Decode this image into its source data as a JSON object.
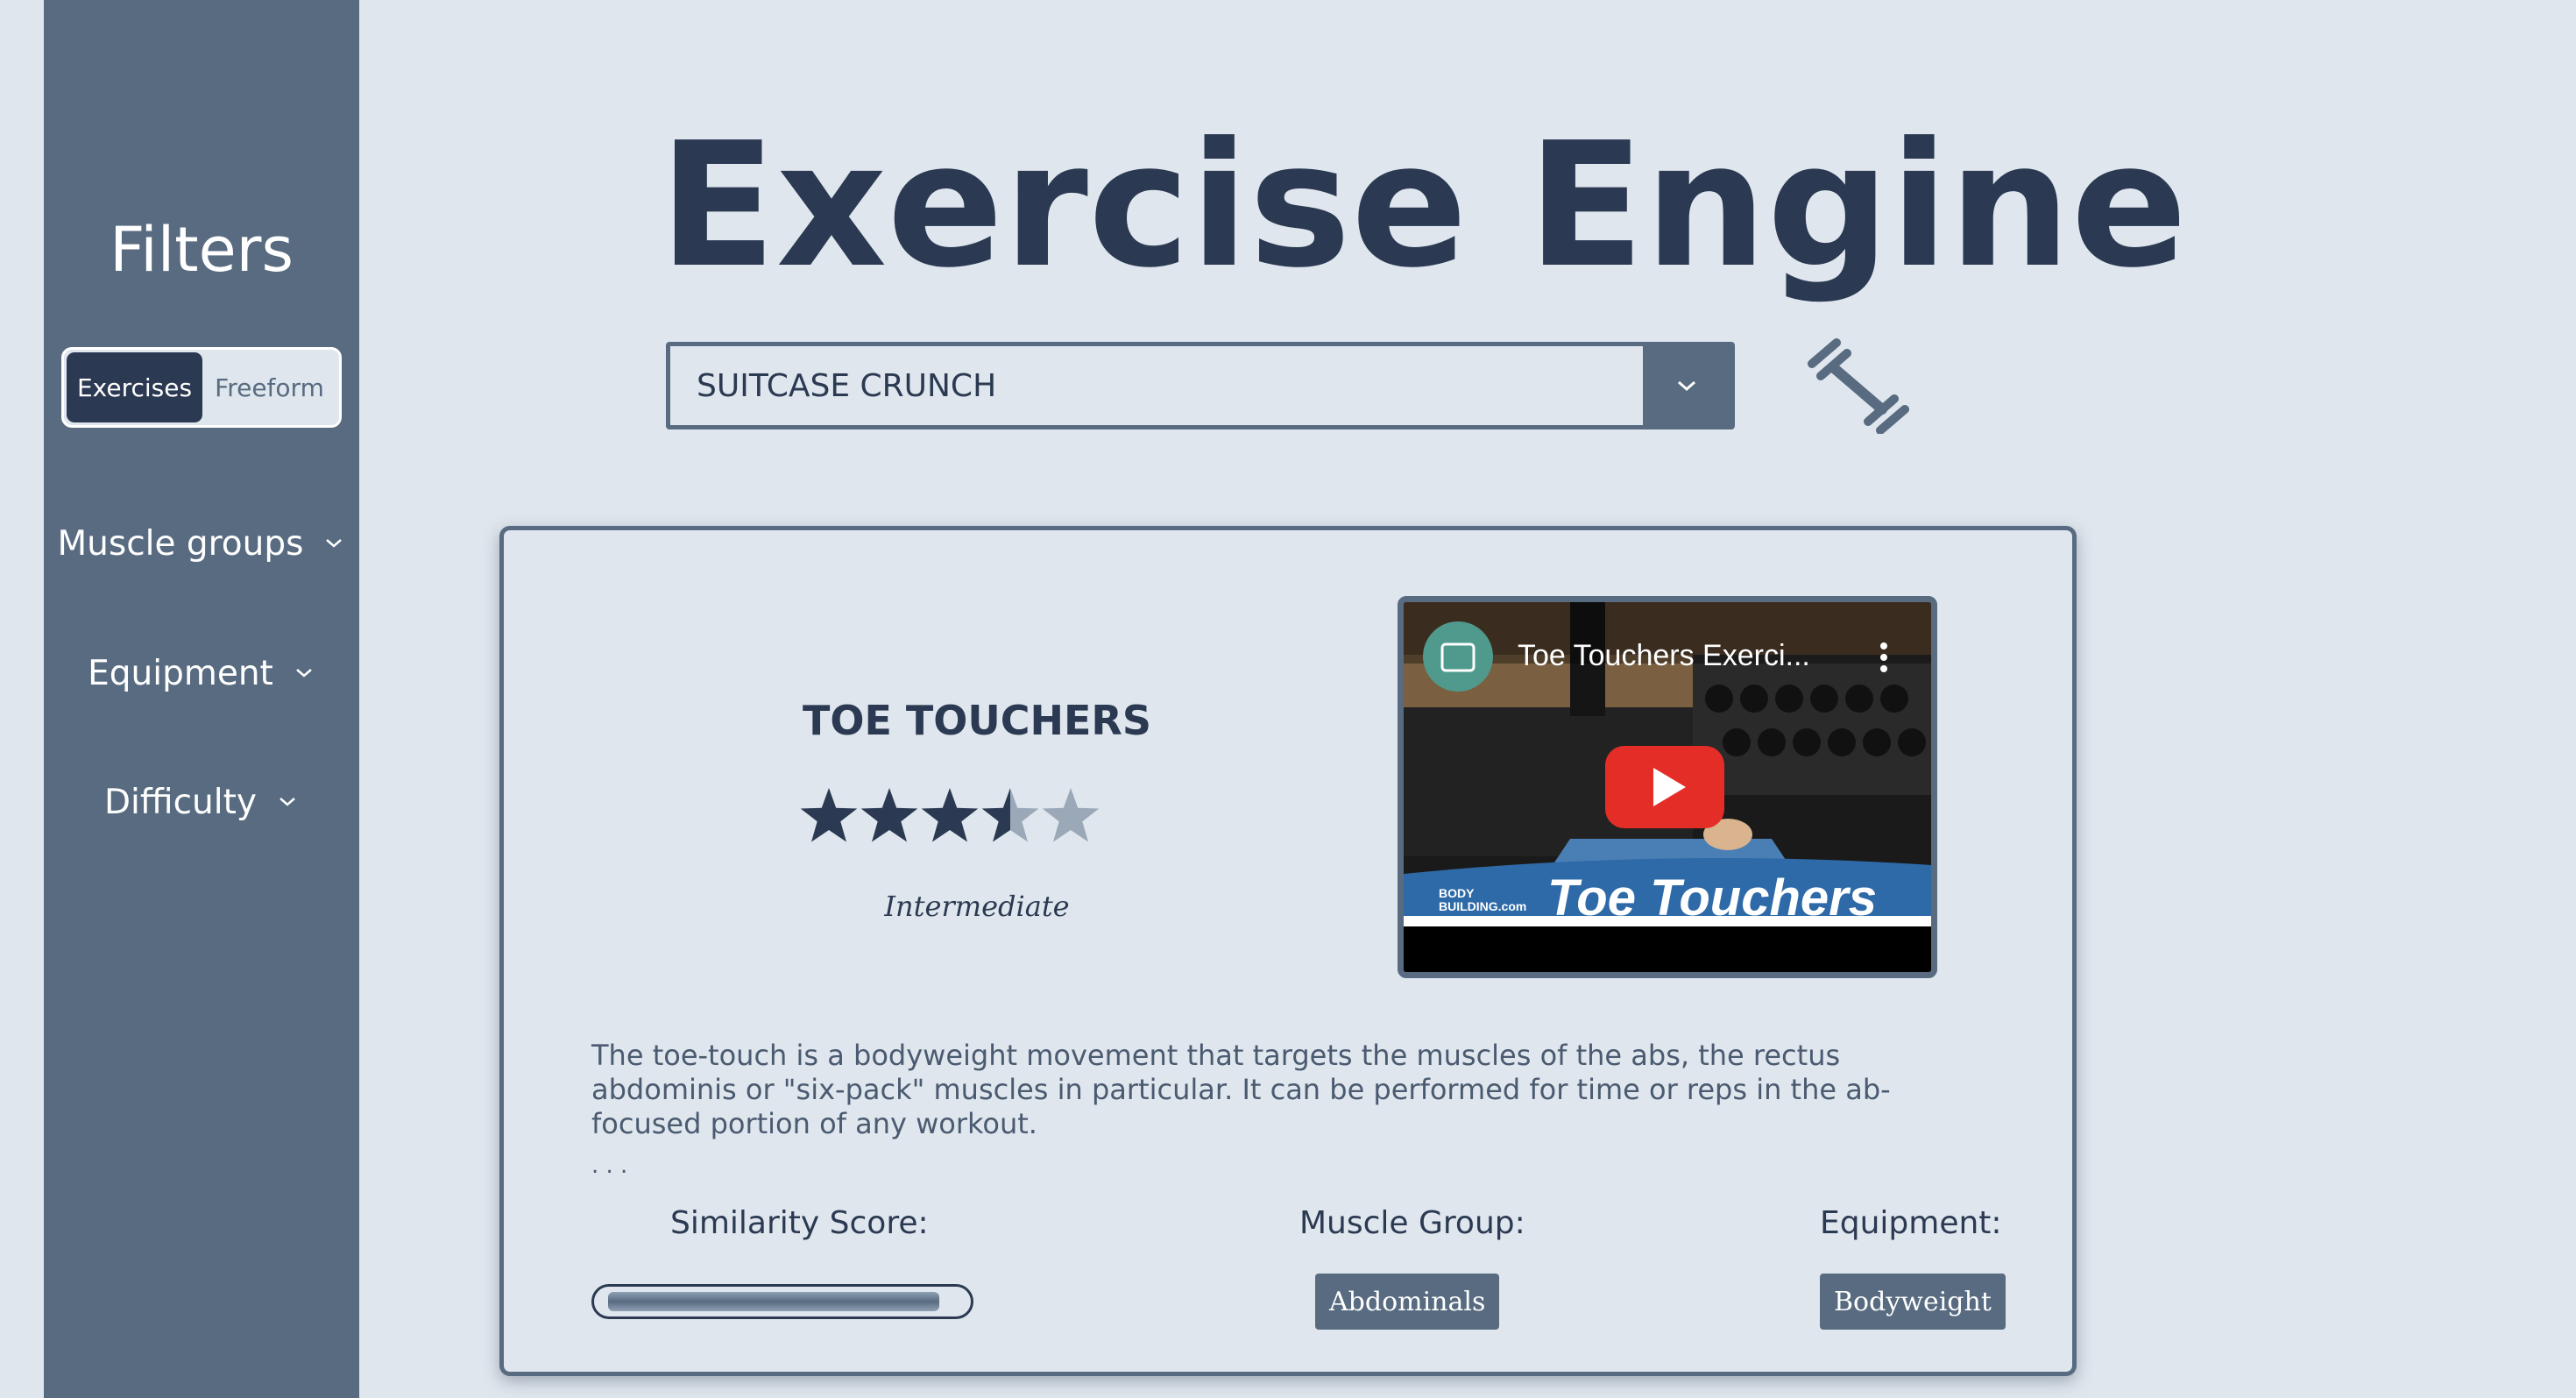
{
  "sidebar": {
    "title": "Filters",
    "mode_toggle": {
      "options": [
        "Exercises",
        "Freeform"
      ],
      "selected": "Exercises"
    },
    "filters": [
      {
        "label": "Muscle groups"
      },
      {
        "label": "Equipment"
      },
      {
        "label": "Difficulty"
      }
    ]
  },
  "header": {
    "title": "Exercise Engine",
    "search_select_value": "SUITCASE CRUNCH",
    "search_icon": "dumbbell-icon"
  },
  "result": {
    "name": "TOE TOUCHERS",
    "rating": 3.5,
    "rating_max": 5,
    "difficulty": "Intermediate",
    "video": {
      "title": "Toe Touchers Exerci...",
      "overlay_text": "Toe Touchers",
      "brand": "BODY BUILDING.com"
    },
    "description": "The toe-touch is a bodyweight movement that targets the muscles of the abs, the rectus abdominis or \"six-pack\" muscles in particular. It can be performed for time or reps in the ab-focused portion of any workout.",
    "ellipsis": ". . .",
    "similarity_label": "Similarity Score:",
    "similarity_score": 0.95,
    "muscle_group_label": "Muscle Group:",
    "muscle_group": "Abdominals",
    "equipment_label": "Equipment:",
    "equipment": "Bodyweight"
  },
  "colors": {
    "background": "#dfe6ed",
    "sidebar": "#586b80",
    "primary": "#2b3a52",
    "star_empty": "#9aa8b8",
    "youtube_red": "#e52d27"
  }
}
